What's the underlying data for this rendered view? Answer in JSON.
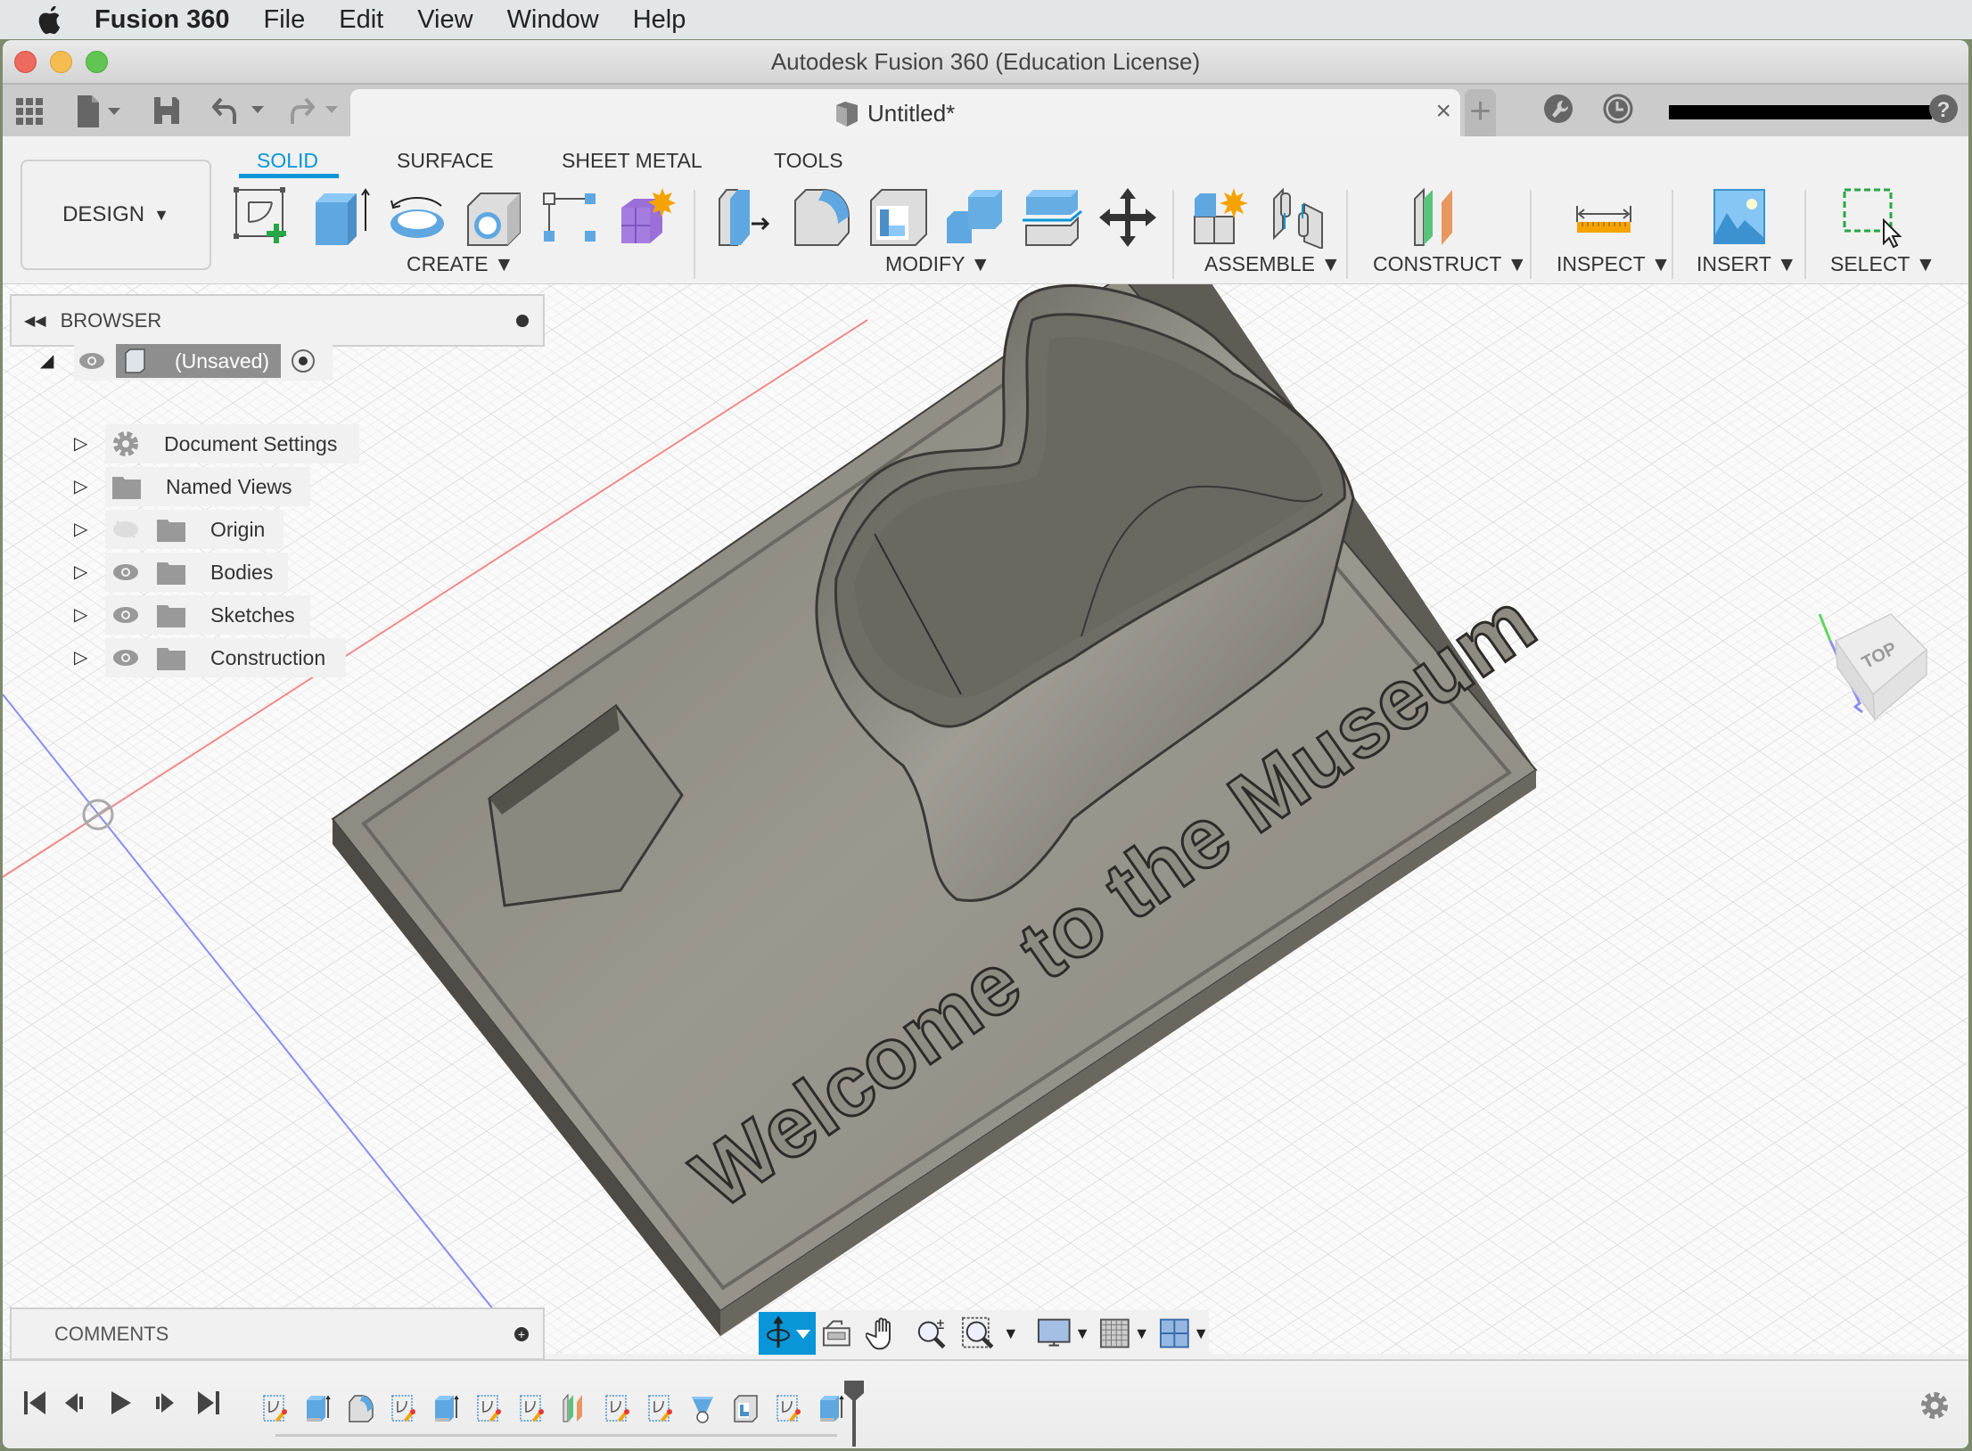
{
  "menubar": {
    "app_name": "Fusion 360",
    "items": [
      "File",
      "Edit",
      "View",
      "Window",
      "Help"
    ]
  },
  "window": {
    "title": "Autodesk Fusion 360 (Education License)",
    "traffic_lights": {
      "close": "#ee6a5f",
      "minimize": "#f5bd4f",
      "zoom": "#61c554"
    }
  },
  "tabbar": {
    "document_tab": "Untitled*",
    "close_glyph": "×",
    "new_tab_glyph": "+",
    "icons": [
      "app-grid-icon",
      "file-icon",
      "save-icon",
      "undo-icon",
      "redo-icon",
      "extensions-icon",
      "job-status-icon",
      "account-name-redacted",
      "help-icon"
    ]
  },
  "toolbar": {
    "workspace": "DESIGN",
    "tabs": [
      {
        "label": "SOLID",
        "active": true
      },
      {
        "label": "SURFACE",
        "active": false
      },
      {
        "label": "SHEET METAL",
        "active": false
      },
      {
        "label": "TOOLS",
        "active": false
      }
    ],
    "groups": {
      "create": "CREATE",
      "modify": "MODIFY",
      "assemble": "ASSEMBLE",
      "construct": "CONSTRUCT",
      "inspect": "INSPECT",
      "insert": "INSERT",
      "select": "SELECT"
    },
    "accent": "#0896d8"
  },
  "browser": {
    "title": "BROWSER",
    "root": "(Unsaved)",
    "items": [
      {
        "label": "Document Settings",
        "icon": "gear-icon",
        "visible": null
      },
      {
        "label": "Named Views",
        "icon": "folder-icon",
        "visible": null
      },
      {
        "label": "Origin",
        "icon": "folder-icon",
        "visible": false
      },
      {
        "label": "Bodies",
        "icon": "folder-icon",
        "visible": true
      },
      {
        "label": "Sketches",
        "icon": "folder-icon",
        "visible": true
      },
      {
        "label": "Construction",
        "icon": "folder-icon",
        "visible": true
      }
    ]
  },
  "comments": {
    "title": "COMMENTS"
  },
  "viewport": {
    "model_text": "Welcome to the Museum",
    "viewcube_face": "TOP",
    "body_color": "#8d8a83"
  },
  "navbar": {
    "tools": [
      "orbit-icon",
      "look-at-icon",
      "pan-icon",
      "zoom-icon",
      "fit-icon",
      "display-settings-icon",
      "grid-icon",
      "viewports-icon"
    ]
  },
  "timeline": {
    "features": [
      "sketch",
      "extrude",
      "fillet",
      "sketch",
      "extrude",
      "sketch",
      "sketch",
      "plane",
      "sketch",
      "sketch",
      "loft",
      "shell",
      "sketch",
      "extrude"
    ]
  }
}
